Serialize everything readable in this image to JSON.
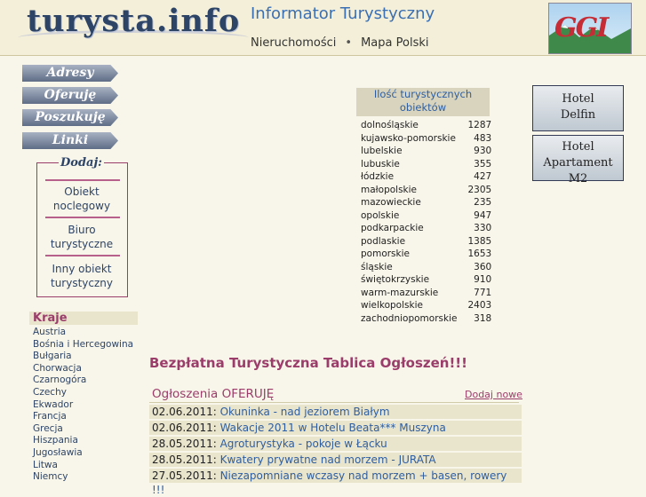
{
  "header": {
    "logo": "turysta.info",
    "site_title": "Informator Turystyczny",
    "nav": [
      "Nieruchomości",
      "Mapa Polski"
    ],
    "nav_sep": "•",
    "banner": "GGI"
  },
  "menu": [
    "Adresy",
    "Oferuję",
    "Poszukuję",
    "Linki"
  ],
  "dodaj": {
    "label": "Dodaj:",
    "items": [
      "Obiekt noclegowy",
      "Biuro turystyczne",
      "Inny obiekt turystyczny"
    ]
  },
  "kraje": {
    "heading": "Kraje",
    "items": [
      "Austria",
      "Bośnia i Hercegowina",
      "Bułgaria",
      "Chorwacja",
      "Czarnogóra",
      "Czechy",
      "Ekwador",
      "Francja",
      "Grecja",
      "Hiszpania",
      "Jugosławia",
      "Litwa",
      "Niemcy"
    ]
  },
  "stats": {
    "heading": "Ilość turystycznych obiektów",
    "rows": [
      {
        "region": "dolnośląskie",
        "count": "1287"
      },
      {
        "region": "kujawsko-pomorskie",
        "count": "483"
      },
      {
        "region": "lubelskie",
        "count": "930"
      },
      {
        "region": "lubuskie",
        "count": "355"
      },
      {
        "region": "łódzkie",
        "count": "427"
      },
      {
        "region": "małopolskie",
        "count": "2305"
      },
      {
        "region": "mazowieckie",
        "count": "235"
      },
      {
        "region": "opolskie",
        "count": "947"
      },
      {
        "region": "podkarpackie",
        "count": "330"
      },
      {
        "region": "podlaskie",
        "count": "1385"
      },
      {
        "region": "pomorskie",
        "count": "1653"
      },
      {
        "region": "śląskie",
        "count": "360"
      },
      {
        "region": "świętokrzyskie",
        "count": "910"
      },
      {
        "region": "warm-mazurskie",
        "count": "771"
      },
      {
        "region": "wielkopolskie",
        "count": "2403"
      },
      {
        "region": "zachodniopomorskie",
        "count": "318"
      }
    ]
  },
  "hotels": [
    {
      "line1": "Hotel",
      "line2": "Delfin"
    },
    {
      "line1": "Hotel",
      "line2": "Apartament M2"
    }
  ],
  "board": {
    "title": "Bezpłatna Turystyczna Tablica Ogłoszeń!!!",
    "section": "Ogłoszenia OFERUJĘ",
    "add_new": "Dodaj nowe",
    "ads": [
      {
        "date": "02.06.2011:",
        "title": "Okuninka - nad jeziorem Białym"
      },
      {
        "date": "02.06.2011:",
        "title": "Wakacje 2011 w Hotelu Beata*** Muszyna"
      },
      {
        "date": "28.05.2011:",
        "title": "Agroturystyka - pokoje w Łącku"
      },
      {
        "date": "28.05.2011:",
        "title": "Kwatery prywatne nad morzem - JURATA"
      },
      {
        "date": "27.05.2011:",
        "title": "Niezapomniane wczasy nad morzem + basen, rowery !!!"
      }
    ]
  }
}
